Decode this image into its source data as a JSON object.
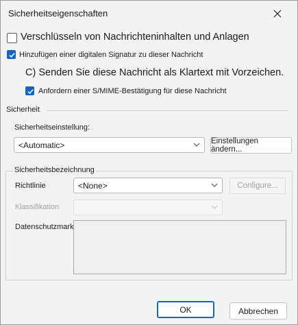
{
  "window": {
    "title": "Sicherheitseigenschaften"
  },
  "options": {
    "encrypt": {
      "label": "Verschlüsseln von Nachrichteninhalten und Anlagen",
      "checked": false
    },
    "sign": {
      "label": "Hinzufügen einer digitalen Signatur zu dieser Nachricht",
      "checked": true
    },
    "clear_text_label": "C) Senden Sie diese Nachricht als Klartext mit Vorzeichen.",
    "smime_receipt": {
      "label": "Anfordern einer S/MIME-Bestätigung für diese Nachricht",
      "checked": true
    }
  },
  "security": {
    "group_title": "Sicherheit",
    "setting_label": "Sicherheitseinstellung:",
    "setting_value": "<Automatic>",
    "change_settings_button": "Einstellungen ändern..."
  },
  "label_section": {
    "group_title": "Sicherheitsbezeichnung",
    "policy_label": "Richtlinie",
    "policy_value": "<None>",
    "configure_button": "Configure...",
    "classification_label": "Klassifikation",
    "privacy_mark_label": "Datenschutzmarkierung:"
  },
  "footer": {
    "ok_button": "OK",
    "cancel_button": "Abbrechen"
  },
  "icons": {
    "close": "close-icon",
    "checkmark": "checkmark-icon",
    "dropdown": "chevron-down-icon"
  },
  "colors": {
    "accent": "#1565c0",
    "disabled_text": "#a0a0a0"
  }
}
